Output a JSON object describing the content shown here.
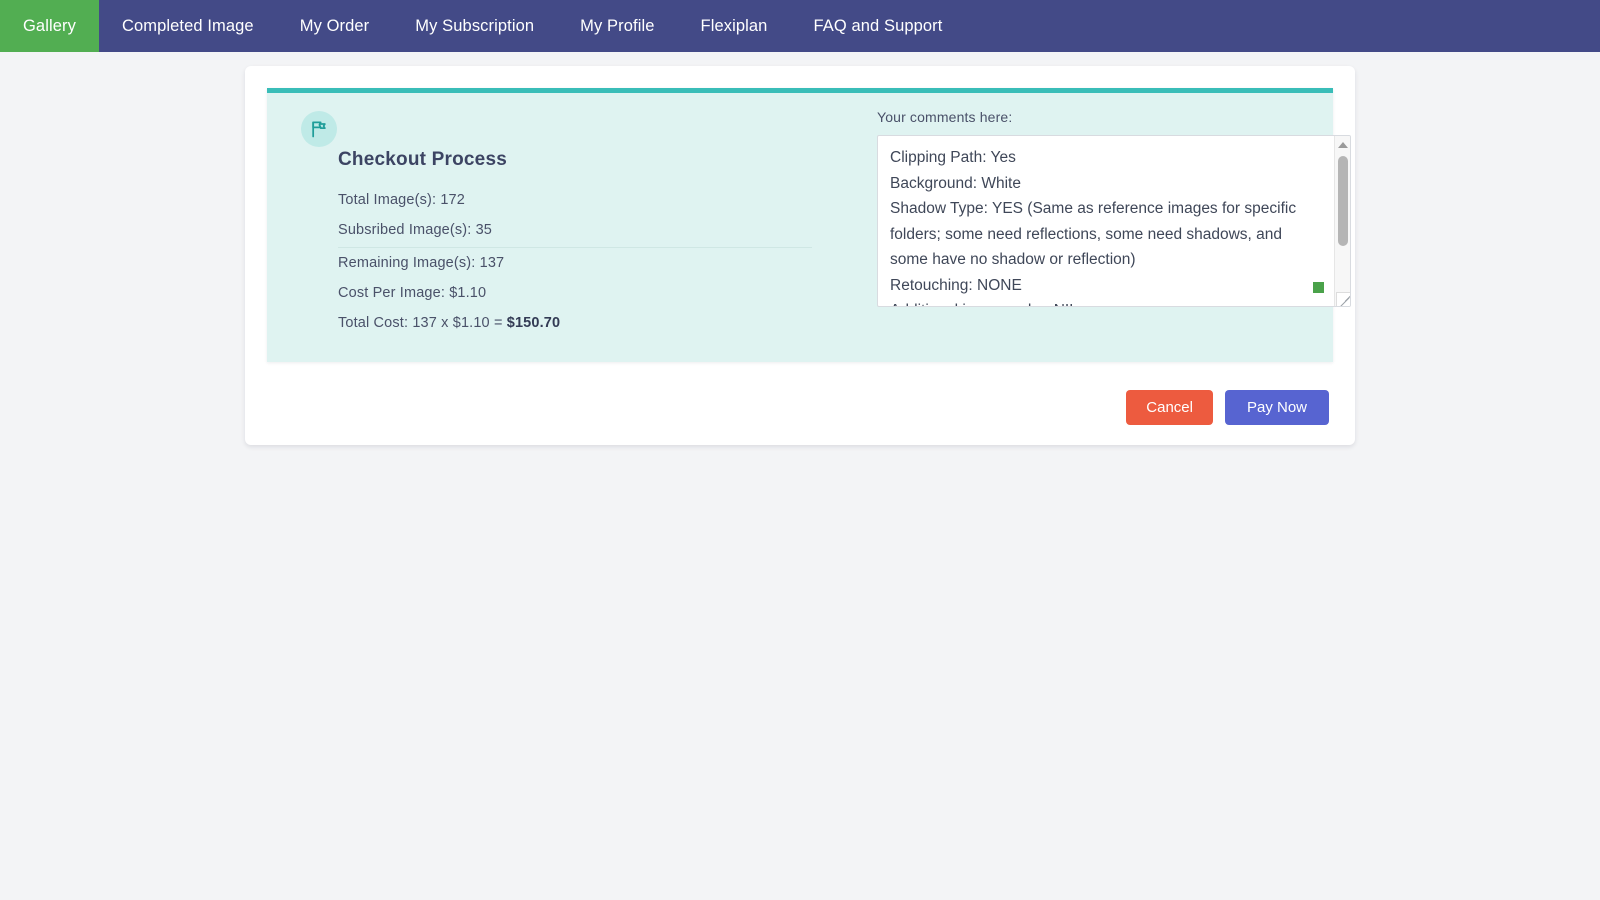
{
  "nav": {
    "items": [
      {
        "label": "Gallery",
        "active": true
      },
      {
        "label": "Completed Image",
        "active": false
      },
      {
        "label": "My Order",
        "active": false
      },
      {
        "label": "My Subscription",
        "active": false
      },
      {
        "label": "My Profile",
        "active": false
      },
      {
        "label": "Flexiplan",
        "active": false
      },
      {
        "label": "FAQ and Support",
        "active": false
      }
    ],
    "bg_color": "#434a87",
    "active_color": "#52ae52"
  },
  "checkout": {
    "icon": "flag-icon",
    "title": "Checkout Process",
    "rows": [
      {
        "label": "Total Image(s): 172"
      },
      {
        "label": "Subsribed Image(s): 35"
      },
      {
        "label": "Remaining Image(s): 137"
      },
      {
        "label": "Cost Per Image: $1.10"
      }
    ],
    "total_cost_prefix": "Total Cost: 137 x $1.10 = ",
    "total_cost_value": "$150.70",
    "accent_color": "#39bdb8",
    "panel_bg": "#dff3f1"
  },
  "comments": {
    "label": "Your comments here:",
    "value": "Clipping Path: Yes\nBackground: White\nShadow Type: YES (Same as reference images for specific folders; some need reflections, some need shadows, and some have no shadow or reflection)\nRetouching: NONE\nAdditional image order: NIL"
  },
  "actions": {
    "cancel_label": "Cancel",
    "pay_label": "Pay Now",
    "cancel_color": "#ed5b3f",
    "pay_color": "#5764d1"
  }
}
